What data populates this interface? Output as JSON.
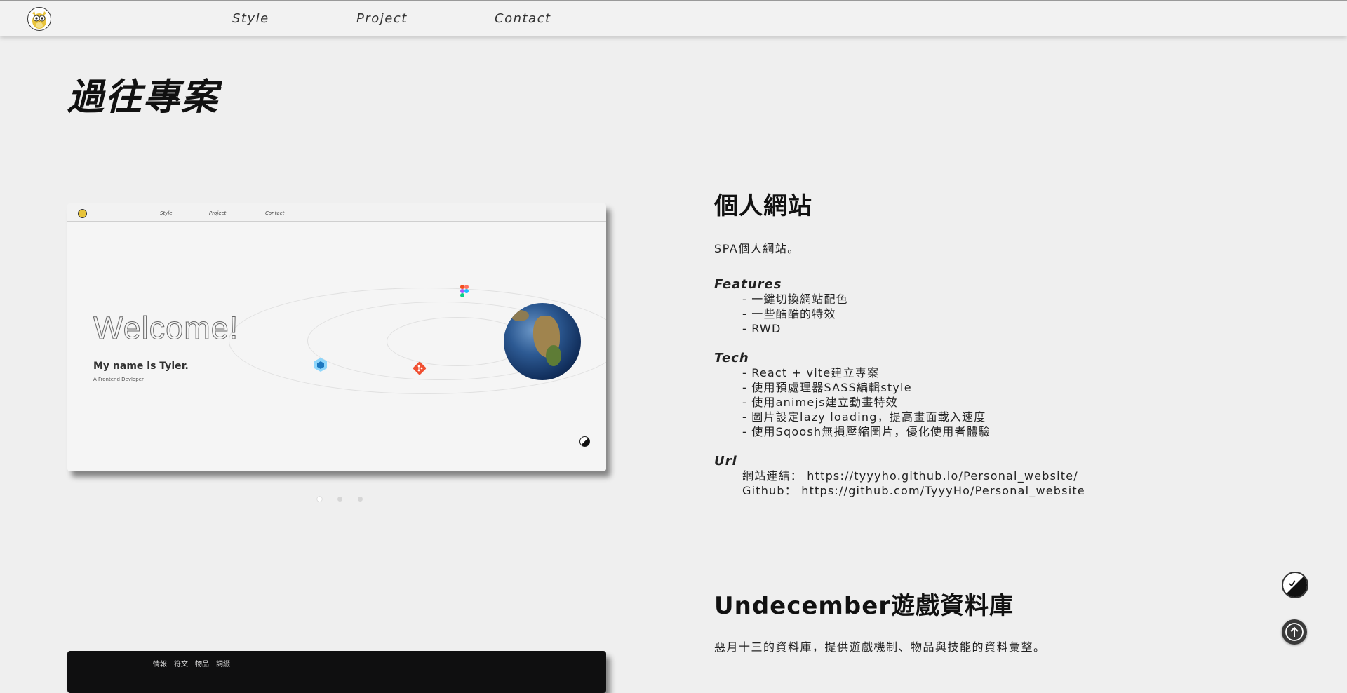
{
  "nav": {
    "links": [
      "Style",
      "Project",
      "Contact"
    ]
  },
  "page_title": "過往專案",
  "project1": {
    "preview": {
      "nav_links": [
        "Style",
        "Project",
        "Contact"
      ],
      "welcome": "Welcome!",
      "name_line": "My name is Tyler.",
      "tagline": "A Frontend Devloper"
    },
    "carousel": {
      "count": 3,
      "active_index": 0
    },
    "title": "個人網站",
    "description": "SPA個人網站。",
    "features_title": "Features",
    "features": [
      "- 一鍵切換網站配色",
      "- 一些酷酷的特效",
      "- RWD"
    ],
    "tech_title": "Tech",
    "tech": [
      "- React + vite建立專案",
      "- 使用預處理器SASS編輯style",
      "- 使用animejs建立動畫特效",
      "- 圖片設定lazy loading，提高畫面載入速度",
      "- 使用Sqoosh無損壓縮圖片，優化使用者體驗"
    ],
    "url_title": "Url",
    "urls": [
      "網站連結： https://tyyyho.github.io/Personal_website/",
      "Github： https://github.com/TyyyHo/Personal_website"
    ]
  },
  "project2": {
    "preview_links": [
      "情報",
      "符文",
      "物品",
      "詞綴"
    ],
    "title": "Undecember遊戲資料庫",
    "description": "惡月十三的資料庫，提供遊戲機制、物品與技能的資料彙整。"
  },
  "colors": {
    "background": "#efefef",
    "text": "#1c1c1c",
    "scroll_button": "#3a3a3a"
  },
  "icons": [
    "owl-logo-icon",
    "figma-icon",
    "webpack-icon",
    "git-icon",
    "earth-icon",
    "theme-toggle-icon",
    "arrow-up-icon"
  ]
}
